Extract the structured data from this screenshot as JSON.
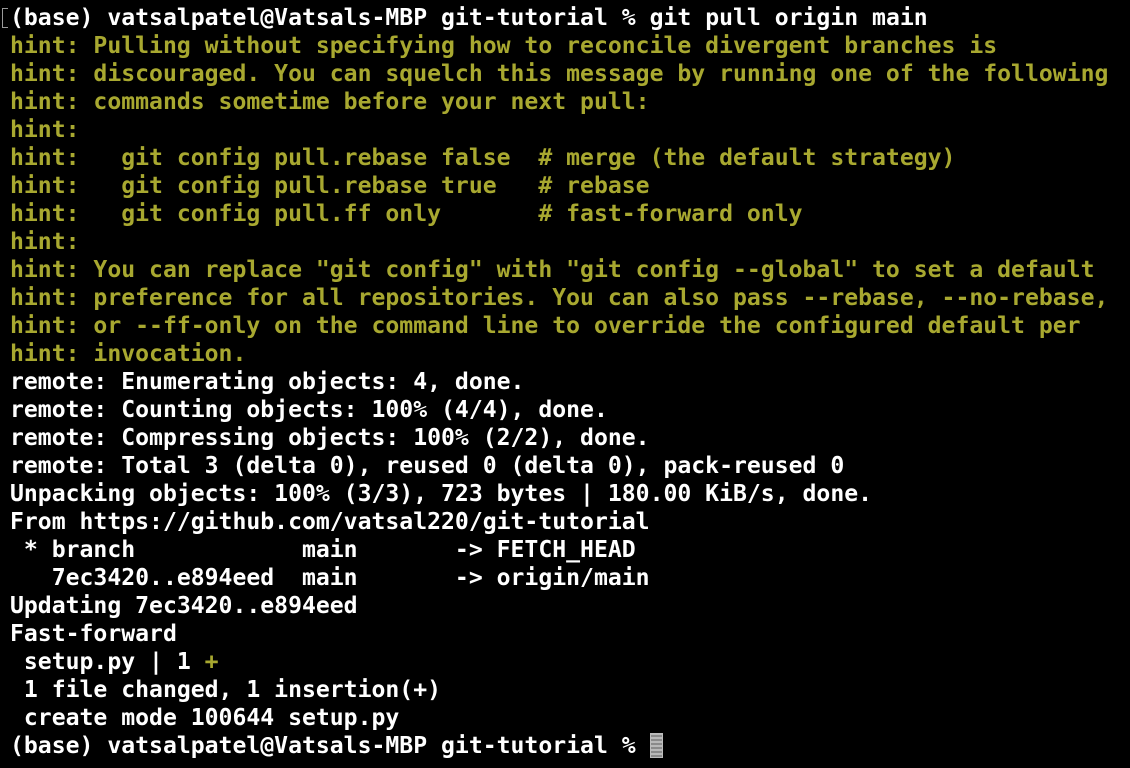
{
  "colors": {
    "background": "#000000",
    "text": "#ffffff",
    "hint": "#a8a830"
  },
  "prompt": "(base) vatsalpatel@Vatsals-MBP git-tutorial % ",
  "command": "git pull origin main",
  "hint_lines": [
    "hint: Pulling without specifying how to reconcile divergent branches is",
    "hint: discouraged. You can squelch this message by running one of the following",
    "hint: commands sometime before your next pull:",
    "hint:",
    "hint:   git config pull.rebase false  # merge (the default strategy)",
    "hint:   git config pull.rebase true   # rebase",
    "hint:   git config pull.ff only       # fast-forward only",
    "hint:",
    "hint: You can replace \"git config\" with \"git config --global\" to set a default",
    "hint: preference for all repositories. You can also pass --rebase, --no-rebase,",
    "hint: or --ff-only on the command line to override the configured default per",
    "hint: invocation."
  ],
  "output_lines": [
    "remote: Enumerating objects: 4, done.",
    "remote: Counting objects: 100% (4/4), done.",
    "remote: Compressing objects: 100% (2/2), done.",
    "remote: Total 3 (delta 0), reused 0 (delta 0), pack-reused 0",
    "Unpacking objects: 100% (3/3), 723 bytes | 180.00 KiB/s, done.",
    "From https://github.com/vatsal220/git-tutorial",
    " * branch            main       -> FETCH_HEAD",
    "   7ec3420..e894eed  main       -> origin/main",
    "Updating 7ec3420..e894eed",
    "Fast-forward"
  ],
  "diffstat_file": " setup.py | 1 ",
  "diffstat_plus": "+",
  "summary_lines": [
    " 1 file changed, 1 insertion(+)",
    " create mode 100644 setup.py"
  ],
  "final_prompt": "(base) vatsalpatel@Vatsals-MBP git-tutorial % "
}
